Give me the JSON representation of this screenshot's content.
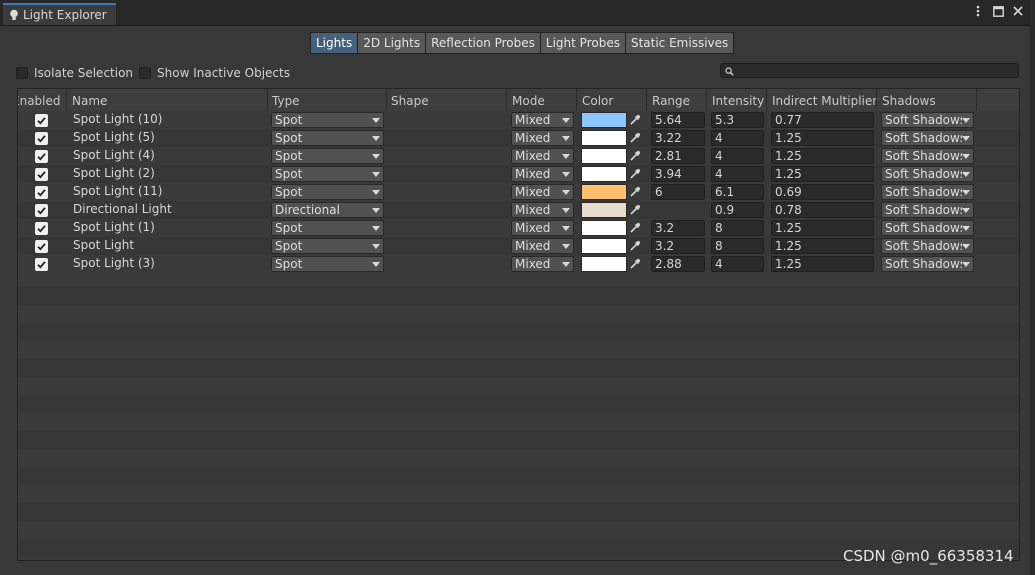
{
  "window": {
    "title": "Light Explorer"
  },
  "tabs": [
    {
      "label": "Lights",
      "active": true
    },
    {
      "label": "2D Lights",
      "active": false
    },
    {
      "label": "Reflection Probes",
      "active": false
    },
    {
      "label": "Light Probes",
      "active": false
    },
    {
      "label": "Static Emissives",
      "active": false
    }
  ],
  "options": {
    "isolate_selection": "Isolate Selection",
    "show_inactive": "Show Inactive Objects"
  },
  "search": {
    "placeholder": "",
    "value": ""
  },
  "columns": {
    "enabled": "Enabled",
    "name": "Name",
    "type": "Type",
    "shape": "Shape",
    "mode": "Mode",
    "color": "Color",
    "range": "Range",
    "intensity": "Intensity",
    "indirect": "Indirect Multiplier",
    "shadows": "Shadows"
  },
  "rows": [
    {
      "enabled": true,
      "name": "Spot Light (10)",
      "type": "Spot",
      "mode": "Mixed",
      "color": "#8cc8ff",
      "range": "5.64",
      "intensity": "5.3",
      "indirect": "0.77",
      "shadows": "Soft Shadows"
    },
    {
      "enabled": true,
      "name": "Spot Light (5)",
      "type": "Spot",
      "mode": "Mixed",
      "color": "#ffffff",
      "range": "3.22",
      "intensity": "4",
      "indirect": "1.25",
      "shadows": "Soft Shadows"
    },
    {
      "enabled": true,
      "name": "Spot Light (4)",
      "type": "Spot",
      "mode": "Mixed",
      "color": "#ffffff",
      "range": "2.81",
      "intensity": "4",
      "indirect": "1.25",
      "shadows": "Soft Shadows"
    },
    {
      "enabled": true,
      "name": "Spot Light (2)",
      "type": "Spot",
      "mode": "Mixed",
      "color": "#ffffff",
      "range": "3.94",
      "intensity": "4",
      "indirect": "1.25",
      "shadows": "Soft Shadows"
    },
    {
      "enabled": true,
      "name": "Spot Light (11)",
      "type": "Spot",
      "mode": "Mixed",
      "color": "#ffc170",
      "range": "6",
      "intensity": "6.1",
      "indirect": "0.69",
      "shadows": "Soft Shadows"
    },
    {
      "enabled": true,
      "name": "Directional Light",
      "type": "Directional",
      "mode": "Mixed",
      "color": "#e6dccb",
      "range": "",
      "intensity": "0.9",
      "indirect": "0.78",
      "shadows": "Soft Shadows"
    },
    {
      "enabled": true,
      "name": "Spot Light (1)",
      "type": "Spot",
      "mode": "Mixed",
      "color": "#ffffff",
      "range": "3.2",
      "intensity": "8",
      "indirect": "1.25",
      "shadows": "Soft Shadows"
    },
    {
      "enabled": true,
      "name": "Spot Light",
      "type": "Spot",
      "mode": "Mixed",
      "color": "#ffffff",
      "range": "3.2",
      "intensity": "8",
      "indirect": "1.25",
      "shadows": "Soft Shadows"
    },
    {
      "enabled": true,
      "name": "Spot Light (3)",
      "type": "Spot",
      "mode": "Mixed",
      "color": "#ffffff",
      "range": "2.88",
      "intensity": "4",
      "indirect": "1.25",
      "shadows": "Soft Shadows"
    }
  ],
  "watermark": "CSDN @m0_66358314",
  "colors": {
    "accent": "#3a79bb",
    "active_tab": "#46607c"
  }
}
